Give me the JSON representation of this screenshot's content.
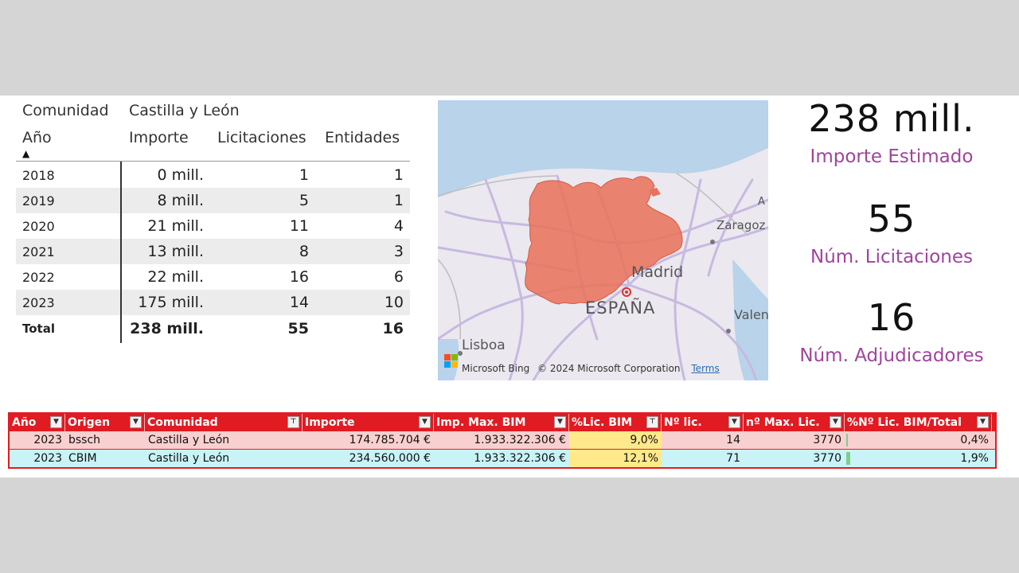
{
  "pivot": {
    "filter_label": "Comunidad",
    "filter_value": "Castilla y León",
    "headers": {
      "year": "Año",
      "importe": "Importe",
      "licitaciones": "Licitaciones",
      "entidades": "Entidades"
    },
    "sort_glyph": "▲",
    "rows": [
      {
        "year": "2018",
        "importe": "0 mill.",
        "licitaciones": "1",
        "entidades": "1"
      },
      {
        "year": "2019",
        "importe": "8 mill.",
        "licitaciones": "5",
        "entidades": "1"
      },
      {
        "year": "2020",
        "importe": "21 mill.",
        "licitaciones": "11",
        "entidades": "4"
      },
      {
        "year": "2021",
        "importe": "13 mill.",
        "licitaciones": "8",
        "entidades": "3"
      },
      {
        "year": "2022",
        "importe": "22 mill.",
        "licitaciones": "16",
        "entidades": "6"
      },
      {
        "year": "2023",
        "importe": "175 mill.",
        "licitaciones": "14",
        "entidades": "10"
      }
    ],
    "total": {
      "year": "Total",
      "importe": "238 mill.",
      "licitaciones": "55",
      "entidades": "16"
    }
  },
  "map": {
    "labels": {
      "zaragoza": "Zaragoz",
      "madrid": "Madrid",
      "espana": "ESPAÑA",
      "lisboa": "Lisboa",
      "valencia": "Valen",
      "edge": "A"
    },
    "credit": "Microsoft Bing",
    "copyright": "© 2024 Microsoft Corporation",
    "terms": "Terms",
    "region_color": "#e8735d",
    "road_color": "#c4b6de"
  },
  "kpis": [
    {
      "value": "238 mill.",
      "label": "Importe Estimado"
    },
    {
      "value": "55",
      "label": "Núm. Licitaciones"
    },
    {
      "value": "16",
      "label": "Núm. Adjudicadores"
    }
  ],
  "sheet": {
    "header_color": "#e11b22",
    "columns": [
      "Año",
      "Origen",
      "Comunidad",
      "Importe",
      "Imp. Max. BIM",
      "%Lic. BIM",
      "Nº lic.",
      "nº Max. Lic.",
      "%Nº Lic. BIM/Total"
    ],
    "rows": [
      {
        "year": "2023",
        "origen": "bssch",
        "comunidad": "Castilla y León",
        "importe": "174.785.704 €",
        "imp_max": "1.933.322.306 €",
        "pct_lic": "9,0%",
        "n_lic": "14",
        "n_max": "3770",
        "pct_n": "0,4%",
        "pct_n_fill": 0.004
      },
      {
        "year": "2023",
        "origen": "CBIM",
        "comunidad": "Castilla y León",
        "importe": "234.560.000 €",
        "imp_max": "1.933.322.306 €",
        "pct_lic": "12,1%",
        "n_lic": "71",
        "n_max": "3770",
        "pct_n": "1,9%",
        "pct_n_fill": 0.019
      }
    ]
  }
}
